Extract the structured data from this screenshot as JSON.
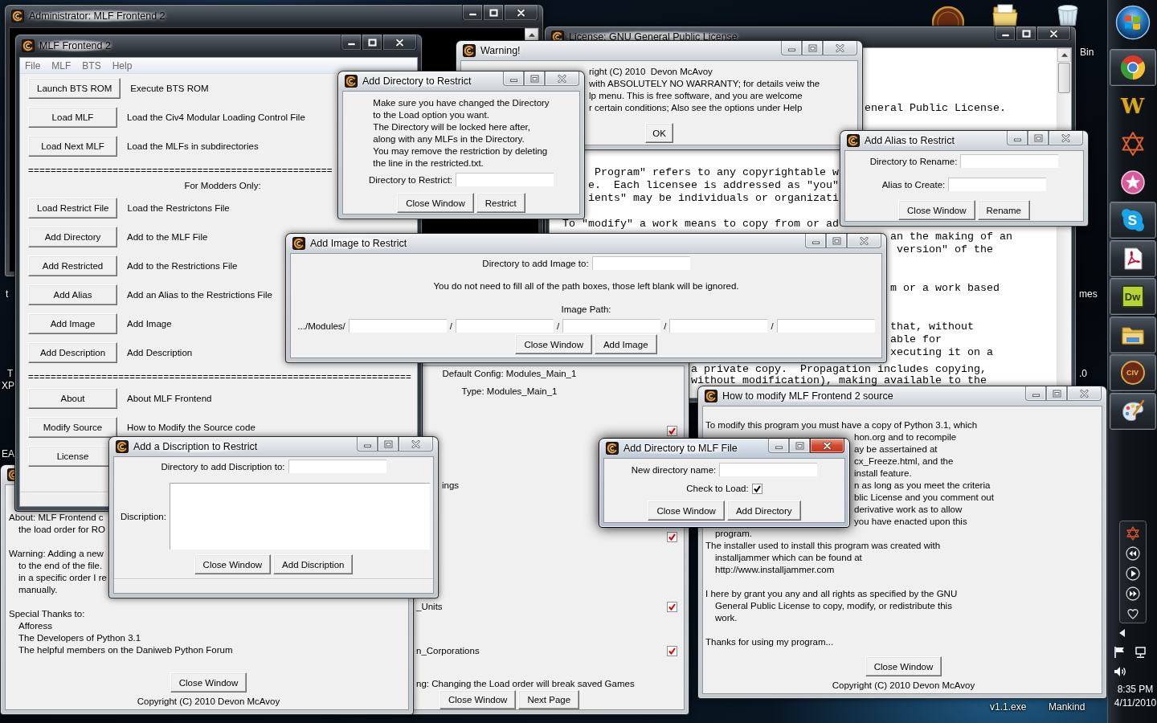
{
  "desktop": {
    "labels": [
      "Bin",
      "t",
      "mes",
      "T",
      ".0",
      "XP",
      "EA",
      "v1.1.exe",
      "Mankind"
    ]
  },
  "console_window": {
    "title": "Administrator: MLF Frontend 2",
    "active": false
  },
  "main_window": {
    "title": "MLF Frontend 2",
    "active": false,
    "menu": [
      "File",
      "MLF",
      "BTS",
      "Help"
    ],
    "groups": [
      {
        "rows": [
          {
            "button": "Launch BTS ROM",
            "description": "Execute BTS ROM"
          },
          {
            "button": "Load MLF",
            "description": "Load the Civ4 Modular Loading Control File"
          },
          {
            "button": "Load Next MLF",
            "description": "Load the MLFs in subdirectories"
          }
        ]
      },
      {
        "separator": "======================================================",
        "heading": "For Modders Only:",
        "rows": [
          {
            "button": "Load Restrict File",
            "description": "Load the Restrictons File"
          },
          {
            "button": "Add Directory",
            "description": "Add to the MLF File"
          },
          {
            "button": "Add Restricted",
            "description": "Add to the Restrictions File"
          },
          {
            "button": "Add Alias",
            "description": "Add an Alias to the Restrictions File"
          },
          {
            "button": "Add Image",
            "description": "Add Image"
          },
          {
            "button": "Add Description",
            "description": "Add Description"
          }
        ]
      },
      {
        "separator": "====================================================================",
        "rows": [
          {
            "button": "About",
            "description": "About MLF Frontend"
          },
          {
            "button": "Modify Source",
            "description": "How to Modify the Source code"
          },
          {
            "button": "License"
          }
        ]
      }
    ]
  },
  "restrict_dialog": {
    "title": "Add Directory to Restrict",
    "active": false,
    "lines": [
      "Make sure you have changed the Directory",
      "to the Load option you want.",
      "The Directory will be locked here after,",
      "along with any MLFs in the Directory.",
      "You may remove the restriction by deleting",
      "the line in the restricted.txt."
    ],
    "field_label": "Directory to Restrict:",
    "buttons": [
      "Close Window",
      "Restrict"
    ]
  },
  "warning_dialog": {
    "title": "Warning!",
    "active": false,
    "lines": [
      "right (C) 2010  Devon McAvoy",
      "with ABSOLUTELY NO WARRANTY; for details veiw the",
      "lp menu. This is free software, and you are welcome",
      "r certain conditions; Also see the options under Help"
    ],
    "button": "OK"
  },
  "license_window": {
    "title": "License: GNU General Public License",
    "active": false,
    "text_groups": [
      [
        "eneral Public License."
      ],
      [
        "Program\" refers to any copyrightable w"
      ],
      [
        "e.  Each licensee is addressed as \"you\"",
        "ients\" may be individuals or organizati"
      ],
      [
        "To \"modify\" a work means to copy from or ad"
      ],
      [
        "an the making of an"
      ],
      [
        "version\" of the"
      ],
      [
        "m or a work based"
      ],
      [
        "that, without",
        "able for",
        "xecuting it on a"
      ],
      [
        "a private copy.  Propagation includes copying,",
        "without modification), making available to the"
      ]
    ]
  },
  "alias_dialog": {
    "title": "Add Alias to Restrict",
    "active": false,
    "fields": [
      "Directory to Rename:",
      "Alias to Create:"
    ],
    "buttons": [
      "Close Window",
      "Rename"
    ]
  },
  "image_dialog": {
    "title": "Add Image to Restrict",
    "active": false,
    "field_label": "Directory to add Image to:",
    "note": "You do not need to fill all of the path boxes, those left blank will be ignored.",
    "path_label": "Image Path:",
    "path_parts": [
      ".../Modules/",
      "/",
      "/",
      "/",
      "/"
    ],
    "buttons": [
      "Close Window",
      "Add Image"
    ]
  },
  "about_window": {
    "active": false,
    "paragraphs": [
      [
        "About: MLF Frontend c",
        "the load order for RO"
      ],
      [
        "Warning: Adding a new",
        "to the end of the file.",
        "in a specific order I re",
        "manually."
      ],
      [
        "Special Thanks to:",
        "Afforess",
        "The Developers of Python 3.1",
        "The helpful members on the Daniweb Python Forum"
      ]
    ],
    "button": "Close Window",
    "copyright": "Copyright (C) 2010 Devon McAvoy"
  },
  "description_dialog": {
    "title": "Add a Discription to Restrict",
    "active": false,
    "field_label": "Directory to add Discription to:",
    "text_label": "Discription:",
    "buttons": [
      "Close Window",
      "Add Discription"
    ]
  },
  "modules_window": {
    "active": false,
    "lines": [
      "Default Config: Modules_Main_1",
      "Type: Modules_Main_1"
    ],
    "modules": [
      {
        "checked": true
      },
      {
        "name": "ings"
      },
      {
        "checked": true
      },
      {
        "name": "_Units",
        "checked": true
      },
      {
        "name": "n_Corporations",
        "checked": true
      }
    ],
    "warning": "ng: Changing the Load order will break saved Games",
    "buttons": [
      "Close Window",
      "Next Page"
    ]
  },
  "mlf_directory_dialog": {
    "title": "Add Directory to MLF File",
    "active": true,
    "fields": [
      {
        "kind": "text",
        "label": "New directory name:"
      },
      {
        "kind": "checkbox",
        "label": "Check to Load:",
        "checked": true
      }
    ],
    "buttons": [
      "Close Window",
      "Add Directory"
    ]
  },
  "howto_window": {
    "title": "How to modify MLF Frontend 2 source",
    "active": false,
    "text": [
      {
        "kind": "gap"
      },
      {
        "kind": "paragraph",
        "lines": [
          "To modify this program you must have a copy of Python 3.1, which"
        ]
      },
      {
        "kind": "partial",
        "lines": [
          "hon.org and to recompile",
          "ay be assertained at",
          "cx_Freeze.html, and the",
          "install feature.",
          "n as long as you meet the criteria",
          "blic License and you comment out",
          "derivative work as to allow",
          "you have enacted upon this"
        ]
      },
      {
        "kind": "tail",
        "lines": [
          "program."
        ]
      },
      {
        "kind": "paragraph",
        "lines": [
          "The installer used to install this program was created with",
          "installjammer which can be found at",
          "http://www.installjammer.com"
        ]
      },
      {
        "kind": "gap"
      },
      {
        "kind": "paragraph",
        "lines": [
          "I here by grant you any and all rights as specified by the GNU",
          "General Public License to copy, modify, or redistribute this",
          "work."
        ]
      },
      {
        "kind": "gap"
      },
      {
        "kind": "paragraph",
        "lines": [
          "Thanks for using my program..."
        ]
      }
    ],
    "button": "Close Window",
    "copyright": "Copyright (C) 2010 Devon McAvoy"
  },
  "taskbar": {
    "buttons": [
      {
        "running": true
      },
      {
        "running": false,
        "logo": "W"
      },
      {
        "running": false
      },
      {
        "running": false
      },
      {
        "running": true,
        "logo": "S"
      },
      {
        "running": true
      },
      {
        "running": true,
        "logo": "Dw"
      },
      {
        "running": true
      },
      {
        "running": true,
        "logo": "CIV"
      },
      {
        "running": true
      }
    ],
    "clock": {
      "time": "8:35 PM",
      "date": "4/11/2010"
    }
  }
}
